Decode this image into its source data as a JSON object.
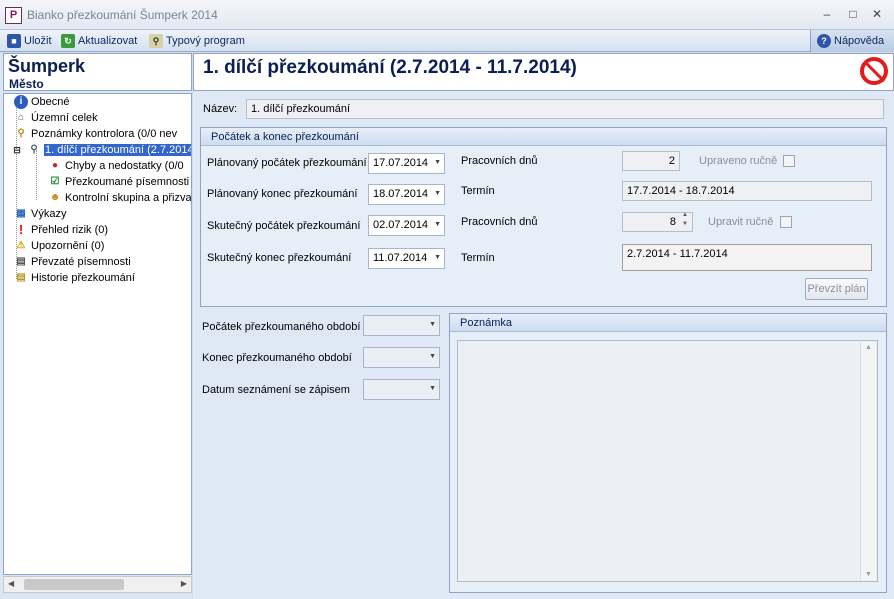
{
  "window": {
    "title": "Bianko přezkoumání Šumperk 2014",
    "app_icon": "P"
  },
  "toolbar": {
    "save_label": "Uložit",
    "refresh_label": "Aktualizovat",
    "template_label": "Typový program",
    "help_label": "Nápověda"
  },
  "left": {
    "city": "Šumperk",
    "city_type": "Město",
    "tree": [
      "Obecné",
      "Územní celek",
      "Poznámky kontrolora (0/0 nev",
      "1. dílčí přezkoumání (2.7.2014",
      "Chyby a nedostatky (0/0",
      "Přezkoumané písemnosti (",
      "Kontrolní skupina a přizvar",
      "Výkazy",
      "Přehled rizik (0)",
      "Upozornění (0)",
      "Převzaté písemnosti",
      "Historie přezkoumání"
    ]
  },
  "header": {
    "title": "1. dílčí přezkoumání (2.7.2014 - 11.7.2014)"
  },
  "form": {
    "name_label": "Název:",
    "name_value": "1. dílčí přezkoumání",
    "group_title": "Počátek a konec přezkoumání",
    "planned_start_label": "Plánovaný počátek přezkoumání",
    "planned_start": "17.07.2014",
    "planned_end_label": "Plánovaný konec přezkoumání",
    "planned_end": "18.07.2014",
    "actual_start_label": "Skutečný počátek přezkoumání",
    "actual_start": "02.07.2014",
    "actual_end_label": "Skutečný konec přezkoumání",
    "actual_end": "11.07.2014",
    "workdays_label": "Pracovních dnů",
    "workdays_planned": "2",
    "workdays_actual": "8",
    "edited_manual_label": "Upraveno ručně",
    "edit_manual_label": "Upravit ručně",
    "term_label": "Termín",
    "term_planned": "17.7.2014 - 18.7.2014",
    "term_actual": "2.7.2014 - 11.7.2014",
    "take_plan_button": "Převzít plán",
    "period_start_label": "Počátek přezkoumaného období",
    "period_end_label": "Konec přezkoumaného období",
    "acquaint_label": "Datum seznámení se zápisem",
    "note_title": "Poznámka"
  },
  "colors": {
    "accent": "#3366cc",
    "title_navy": "#0b1f55",
    "stop": "#e21b1b"
  }
}
